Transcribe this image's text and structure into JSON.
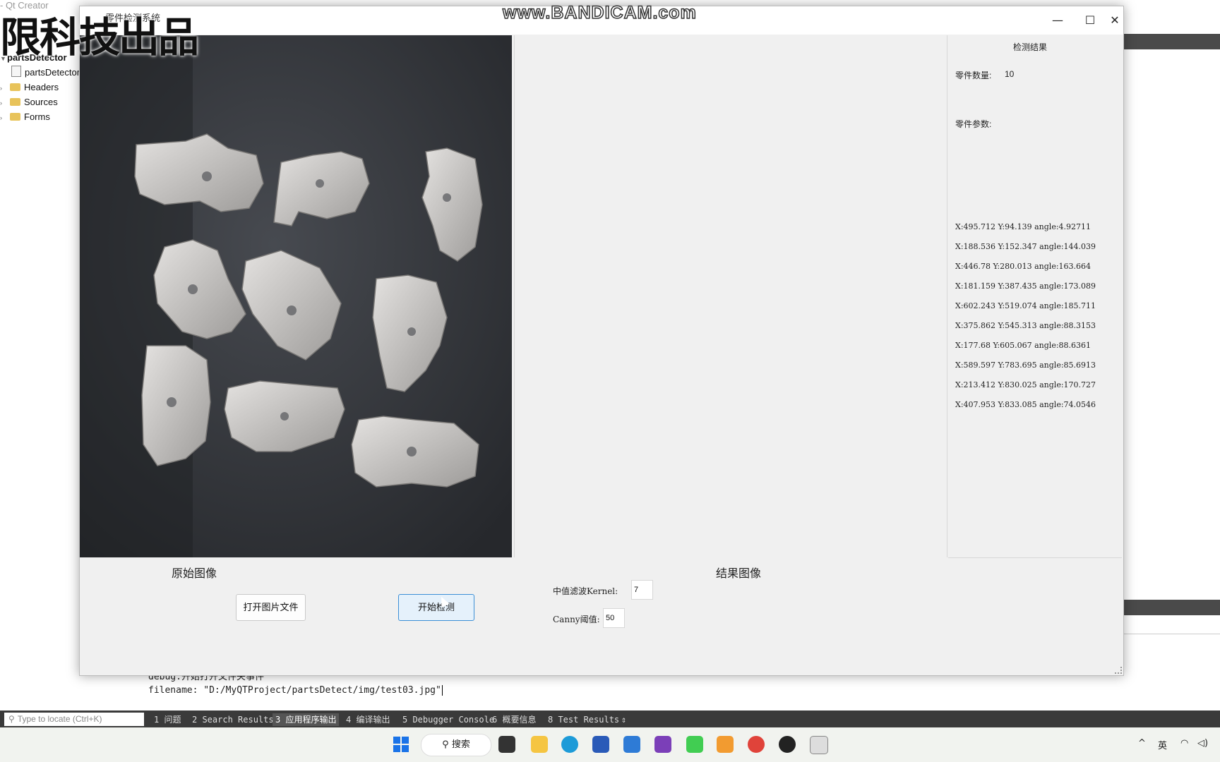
{
  "watermarks": {
    "left_text": "限科技出品",
    "bandicam": "www.BANDICAM.com"
  },
  "qt_creator": {
    "title": "- Qt Creator",
    "project_tree": {
      "root": "partsDetector",
      "items": [
        "partsDetector",
        "Headers",
        "Sources",
        "Forms"
      ]
    },
    "console_lines": [
      "debug:开始打开文件夹事件",
      "filename: \"D:/MyQTProject/partsDetect/img/test03.jpg\""
    ],
    "locator_placeholder": "Type to locate (Ctrl+K)",
    "output_tabs": [
      "1 问题",
      "2 Search Results",
      "3 应用程序输出",
      "4 编译输出",
      "5 Debugger Console",
      "6 概要信息",
      "8 Test Results"
    ]
  },
  "dialog": {
    "title": "零件检测系统",
    "window_controls": {
      "minimize": "—",
      "maximize": "☐",
      "close": "✕"
    },
    "result_panel": {
      "heading": "检测结果",
      "count_label": "零件数量:",
      "count_value": "10",
      "params_label": "零件参数:",
      "coords": [
        "X:495.712   Y:94.139   angle:4.92711",
        "X:188.536   Y:152.347   angle:144.039",
        "X:446.78   Y:280.013   angle:163.664",
        "X:181.159   Y:387.435   angle:173.089",
        "X:602.243   Y:519.074   angle:185.711",
        "X:375.862   Y:545.313   angle:88.3153",
        "X:177.68   Y:605.067   angle:88.6361",
        "X:589.597   Y:783.695   angle:85.6913",
        "X:213.412   Y:830.025   angle:170.727",
        "X:407.953   Y:833.085   angle:74.0546"
      ]
    },
    "labels": {
      "original_image": "原始图像",
      "result_image": "结果图像"
    },
    "buttons": {
      "open_file": "打开图片文件",
      "start_detect": "开始检测"
    },
    "params": {
      "median_kernel_label": "中值滤波Kernel:",
      "median_kernel_value": "7",
      "canny_label": "Canny阈值:",
      "canny_value": "50"
    }
  },
  "taskbar": {
    "search": "搜索",
    "tray_ime": "英"
  }
}
